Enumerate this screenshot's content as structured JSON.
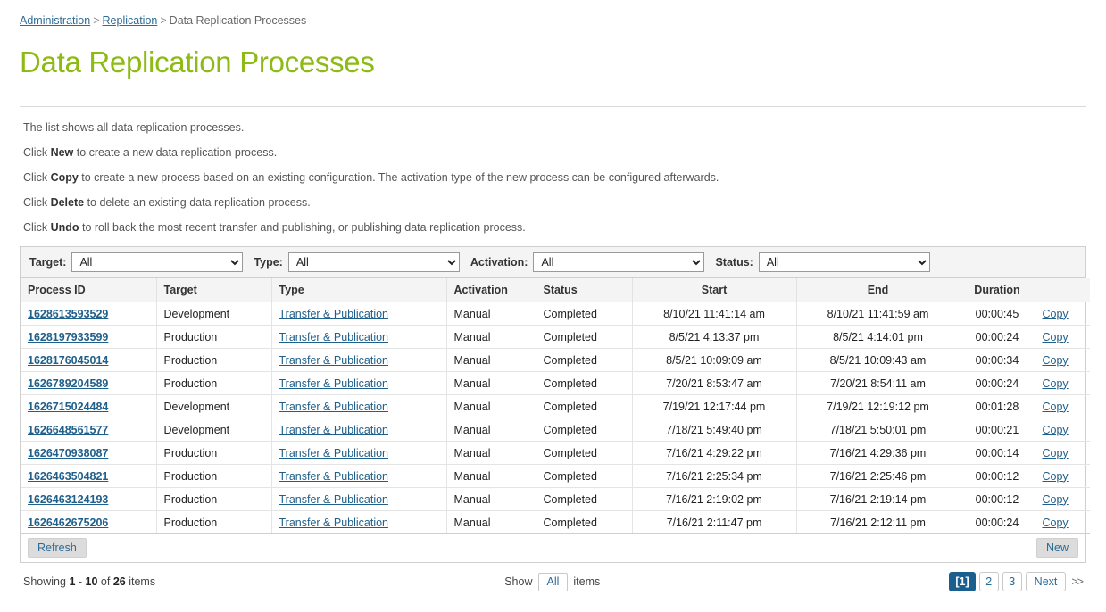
{
  "breadcrumb": {
    "items": [
      {
        "label": "Administration",
        "link": true
      },
      {
        "label": "Replication",
        "link": true
      },
      {
        "label": "Data Replication Processes",
        "link": false
      }
    ],
    "separator": ">"
  },
  "page": {
    "title": "Data Replication Processes",
    "title_color": "#8dba15"
  },
  "intro": {
    "lines": [
      {
        "prefix": "The list shows all data replication processes.",
        "bold": "",
        "suffix": ""
      },
      {
        "prefix": "Click ",
        "bold": "New",
        "suffix": " to create a new data replication process."
      },
      {
        "prefix": "Click ",
        "bold": "Copy",
        "suffix": " to create a new process based on an existing configuration. The activation type of the new process can be configured afterwards."
      },
      {
        "prefix": "Click ",
        "bold": "Delete",
        "suffix": " to delete an existing data replication process."
      },
      {
        "prefix": "Click ",
        "bold": "Undo",
        "suffix": " to roll back the most recent transfer and publishing, or publishing data replication process."
      }
    ]
  },
  "filters": [
    {
      "label": "Target:",
      "value": "All",
      "options": [
        "All"
      ],
      "name": "target"
    },
    {
      "label": "Type:",
      "value": "All",
      "options": [
        "All"
      ],
      "name": "type"
    },
    {
      "label": "Activation:",
      "value": "All",
      "options": [
        "All"
      ],
      "name": "activation"
    },
    {
      "label": "Status:",
      "value": "All",
      "options": [
        "All"
      ],
      "name": "status"
    }
  ],
  "table": {
    "columns": [
      "Process ID",
      "Target",
      "Type",
      "Activation",
      "Status",
      "Start",
      "End",
      "Duration",
      ""
    ],
    "rows": [
      {
        "process_id": "1628613593529",
        "target": "Development",
        "type": "Transfer & Publication",
        "activation": "Manual",
        "status": "Completed",
        "start": "8/10/21 11:41:14 am",
        "end": "8/10/21 11:41:59 am",
        "duration": "00:00:45",
        "copy": "Copy"
      },
      {
        "process_id": "1628197933599",
        "target": "Production",
        "type": "Transfer & Publication",
        "activation": "Manual",
        "status": "Completed",
        "start": "8/5/21 4:13:37 pm",
        "end": "8/5/21 4:14:01 pm",
        "duration": "00:00:24",
        "copy": "Copy"
      },
      {
        "process_id": "1628176045014",
        "target": "Production",
        "type": "Transfer & Publication",
        "activation": "Manual",
        "status": "Completed",
        "start": "8/5/21 10:09:09 am",
        "end": "8/5/21 10:09:43 am",
        "duration": "00:00:34",
        "copy": "Copy"
      },
      {
        "process_id": "1626789204589",
        "target": "Production",
        "type": "Transfer & Publication",
        "activation": "Manual",
        "status": "Completed",
        "start": "7/20/21 8:53:47 am",
        "end": "7/20/21 8:54:11 am",
        "duration": "00:00:24",
        "copy": "Copy"
      },
      {
        "process_id": "1626715024484",
        "target": "Development",
        "type": "Transfer & Publication",
        "activation": "Manual",
        "status": "Completed",
        "start": "7/19/21 12:17:44 pm",
        "end": "7/19/21 12:19:12 pm",
        "duration": "00:01:28",
        "copy": "Copy"
      },
      {
        "process_id": "1626648561577",
        "target": "Development",
        "type": "Transfer & Publication",
        "activation": "Manual",
        "status": "Completed",
        "start": "7/18/21 5:49:40 pm",
        "end": "7/18/21 5:50:01 pm",
        "duration": "00:00:21",
        "copy": "Copy"
      },
      {
        "process_id": "1626470938087",
        "target": "Production",
        "type": "Transfer & Publication",
        "activation": "Manual",
        "status": "Completed",
        "start": "7/16/21 4:29:22 pm",
        "end": "7/16/21 4:29:36 pm",
        "duration": "00:00:14",
        "copy": "Copy"
      },
      {
        "process_id": "1626463504821",
        "target": "Production",
        "type": "Transfer & Publication",
        "activation": "Manual",
        "status": "Completed",
        "start": "7/16/21 2:25:34 pm",
        "end": "7/16/21 2:25:46 pm",
        "duration": "00:00:12",
        "copy": "Copy"
      },
      {
        "process_id": "1626463124193",
        "target": "Production",
        "type": "Transfer & Publication",
        "activation": "Manual",
        "status": "Completed",
        "start": "7/16/21 2:19:02 pm",
        "end": "7/16/21 2:19:14 pm",
        "duration": "00:00:12",
        "copy": "Copy"
      },
      {
        "process_id": "1626462675206",
        "target": "Production",
        "type": "Transfer & Publication",
        "activation": "Manual",
        "status": "Completed",
        "start": "7/16/21 2:11:47 pm",
        "end": "7/16/21 2:12:11 pm",
        "duration": "00:00:24",
        "copy": "Copy"
      }
    ]
  },
  "actions": {
    "refresh_label": "Refresh",
    "new_label": "New"
  },
  "footer": {
    "showing_prefix": "Showing",
    "showing_from": "1",
    "showing_dash": "-",
    "showing_to": "10",
    "showing_of": "of",
    "showing_total": "26",
    "showing_suffix": "items",
    "show_label": "Show",
    "show_value": "All",
    "show_items_label": "items",
    "pages": [
      "[1]",
      "2",
      "3"
    ],
    "next_label": "Next",
    "arrows": ">>"
  }
}
